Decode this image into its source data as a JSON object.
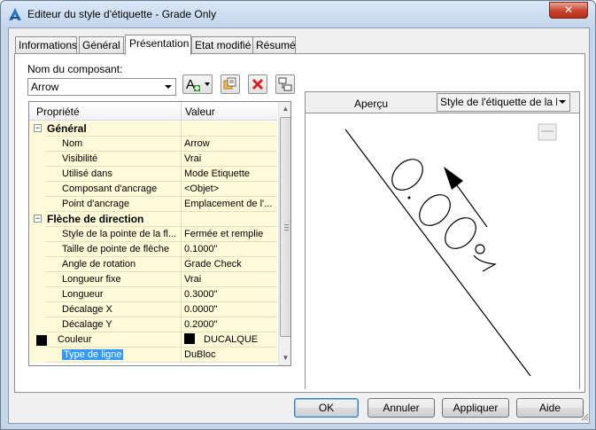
{
  "window": {
    "title": "Editeur du style d'étiquette - Grade Only",
    "close_label": "✕"
  },
  "tabs": [
    {
      "label": "Informations",
      "active": false
    },
    {
      "label": "Général",
      "active": false
    },
    {
      "label": "Présentation",
      "active": true
    },
    {
      "label": "Etat modifié",
      "active": false
    },
    {
      "label": "Résumé",
      "active": false
    }
  ],
  "component": {
    "label": "Nom du composant:",
    "value": "Arrow"
  },
  "toolbar": {
    "add_icon": "text-add-icon",
    "copy_icon": "copy-component-icon",
    "delete_icon": "delete-icon",
    "order_icon": "component-order-icon"
  },
  "grid": {
    "headers": {
      "property": "Propriété",
      "value": "Valeur"
    },
    "rows": [
      {
        "type": "cat",
        "expander": "−",
        "label": "Général",
        "value": ""
      },
      {
        "type": "prop",
        "label": "Nom",
        "value": "Arrow"
      },
      {
        "type": "prop",
        "label": "Visibilité",
        "value": "Vrai"
      },
      {
        "type": "prop",
        "label": "Utilisé dans",
        "value": "Mode Etiquette"
      },
      {
        "type": "prop",
        "label": "Composant d'ancrage",
        "value": "<Objet>"
      },
      {
        "type": "prop",
        "label": "Point d'ancrage",
        "value": "Emplacement de l'..."
      },
      {
        "type": "cat",
        "expander": "−",
        "label": "Flèche de direction",
        "value": ""
      },
      {
        "type": "prop",
        "label": "Style de la pointe de la fl...",
        "value": "Fermée et remplie"
      },
      {
        "type": "prop",
        "label": "Taille de pointe de flèche",
        "value": "0.1000\""
      },
      {
        "type": "prop",
        "label": "Angle de rotation",
        "value": "Grade Check"
      },
      {
        "type": "prop",
        "label": "Longueur fixe",
        "value": "Vrai"
      },
      {
        "type": "prop",
        "label": "Longueur",
        "value": "0.3000\""
      },
      {
        "type": "prop",
        "label": "Décalage X",
        "value": "0.0000\""
      },
      {
        "type": "prop",
        "label": "Décalage Y",
        "value": "0.2000\""
      },
      {
        "type": "color",
        "label": "Couleur",
        "value": "DUCALQUE"
      },
      {
        "type": "selected",
        "label": "Type de ligne",
        "value": "DuBloc"
      }
    ]
  },
  "preview": {
    "label": "Aperçu",
    "style_value": "Style de l'étiquette de la lig",
    "plot_icon": "plot-icon"
  },
  "buttons": {
    "ok": "OK",
    "cancel": "Annuler",
    "apply": "Appliquer",
    "help": "Aide"
  },
  "colors": {
    "accent": "#3399ff",
    "grid_bg": "#fffbd8",
    "title_bg": "#c6d6ea"
  }
}
